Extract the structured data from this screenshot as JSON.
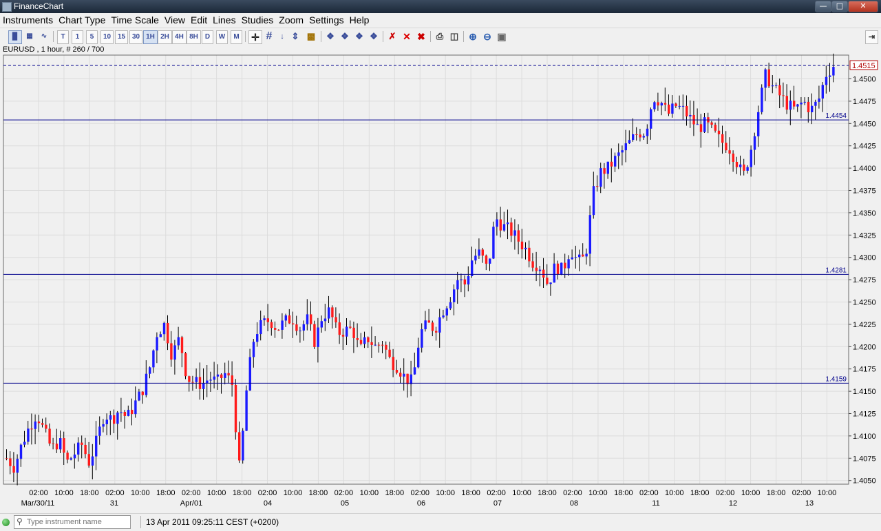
{
  "window": {
    "title": "FinanceChart",
    "controls": [
      "minimize",
      "maximize",
      "close"
    ]
  },
  "menu": [
    "Instruments",
    "Chart Type",
    "Time Scale",
    "View",
    "Edit",
    "Lines",
    "Studies",
    "Zoom",
    "Settings",
    "Help"
  ],
  "toolbar": {
    "chart_type_buttons": [
      "bar-chart-icon",
      "candle-chart-icon",
      "line-chart-icon"
    ],
    "timeframes": [
      "T",
      "1",
      "5",
      "10",
      "15",
      "30",
      "1H",
      "2H",
      "4H",
      "8H",
      "D",
      "W",
      "M"
    ],
    "selected_timeframe": "1H",
    "tools": [
      "crosshair-icon",
      "grid-icon",
      "down-arrow-icon",
      "ruler-icon",
      "volume-icon",
      "line-tool-1-icon",
      "line-tool-2-icon",
      "line-tool-3-icon",
      "line-tool-4-icon",
      "delete-line-icon",
      "delete-icon",
      "delete-all-icon",
      "print-icon",
      "print-preview-icon",
      "zoom-in-icon",
      "zoom-out-icon",
      "zoom-fit-icon"
    ],
    "right_button": "panel-toggle-icon"
  },
  "chart_info": "EURUSD , 1 hour, # 260 / 700",
  "status": {
    "search_placeholder": "Type instrument name",
    "datetime": "13 Apr 2011 09:25:11  CEST (+0200)",
    "connection": "green"
  },
  "colors": {
    "up_candle": "#1a1aff",
    "down_candle": "#ff1a1a",
    "wick": "#000000",
    "hline": "#00008b",
    "current_price_line": "#00008b",
    "current_price_label": "#b00000"
  },
  "chart_data": {
    "type": "candlestick",
    "symbol": "EURUSD",
    "timeframe": "1 hour",
    "ylim": [
      1.4045,
      1.4535
    ],
    "y_ticks": [
      "1.4050",
      "1.4075",
      "1.4100",
      "1.4125",
      "1.4150",
      "1.4175",
      "1.4200",
      "1.4225",
      "1.4250",
      "1.4275",
      "1.4300",
      "1.4325",
      "1.4350",
      "1.4375",
      "1.4400",
      "1.4425",
      "1.4450",
      "1.4475",
      "1.4500"
    ],
    "x_ticks": [
      "02:00",
      "10:00",
      "18:00",
      "02:00",
      "10:00",
      "18:00",
      "02:00",
      "10:00",
      "18:00",
      "02:00",
      "10:00",
      "18:00",
      "02:00",
      "10:00",
      "18:00",
      "02:00",
      "10:00",
      "18:00",
      "02:00",
      "10:00",
      "18:00",
      "02:00",
      "10:00",
      "18:00",
      "02:00",
      "10:00",
      "18:00",
      "02:00",
      "10:00",
      "18:00",
      "02:00",
      "10:00"
    ],
    "date_labels": [
      "Mar/30/11",
      "31",
      "Apr/01",
      "04",
      "05",
      "06",
      "07",
      "08",
      "11",
      "12",
      "13"
    ],
    "horizontal_lines": [
      1.4454,
      1.4281,
      1.4159
    ],
    "horizontal_line_labels": [
      "1.4454",
      "1.4281",
      "1.4159"
    ],
    "current_price": 1.4515,
    "current_price_label": "1.4515",
    "grid": true,
    "path": [
      1.4075,
      1.4065,
      1.409,
      1.411,
      1.4125,
      1.4105,
      1.4085,
      1.4095,
      1.407,
      1.408,
      1.409,
      1.407,
      1.4095,
      1.4125,
      1.4118,
      1.413,
      1.412,
      1.4135,
      1.415,
      1.4175,
      1.4215,
      1.4225,
      1.419,
      1.421,
      1.4165,
      1.416,
      1.4158,
      1.4165,
      1.416,
      1.417,
      1.4158,
      1.406,
      1.416,
      1.4215,
      1.4225,
      1.423,
      1.422,
      1.4228,
      1.4232,
      1.422,
      1.423,
      1.4205,
      1.4235,
      1.424,
      1.4215,
      1.4218,
      1.422,
      1.4195,
      1.421,
      1.42,
      1.4205,
      1.4185,
      1.4178,
      1.4165,
      1.416,
      1.4215,
      1.4225,
      1.422,
      1.424,
      1.4255,
      1.4275,
      1.427,
      1.43,
      1.4305,
      1.4285,
      1.4345,
      1.4335,
      1.433,
      1.432,
      1.431,
      1.4295,
      1.429,
      1.427,
      1.429,
      1.4285,
      1.431,
      1.4295,
      1.43,
      1.437,
      1.4395,
      1.44,
      1.441,
      1.442,
      1.443,
      1.444,
      1.444,
      1.448,
      1.4475,
      1.446,
      1.447,
      1.4465,
      1.4455,
      1.4445,
      1.445,
      1.444,
      1.443,
      1.4425,
      1.441,
      1.439,
      1.442,
      1.4465,
      1.4505,
      1.449,
      1.448,
      1.447,
      1.4465,
      1.4475,
      1.4465,
      1.4475,
      1.4505,
      1.4515
    ]
  }
}
